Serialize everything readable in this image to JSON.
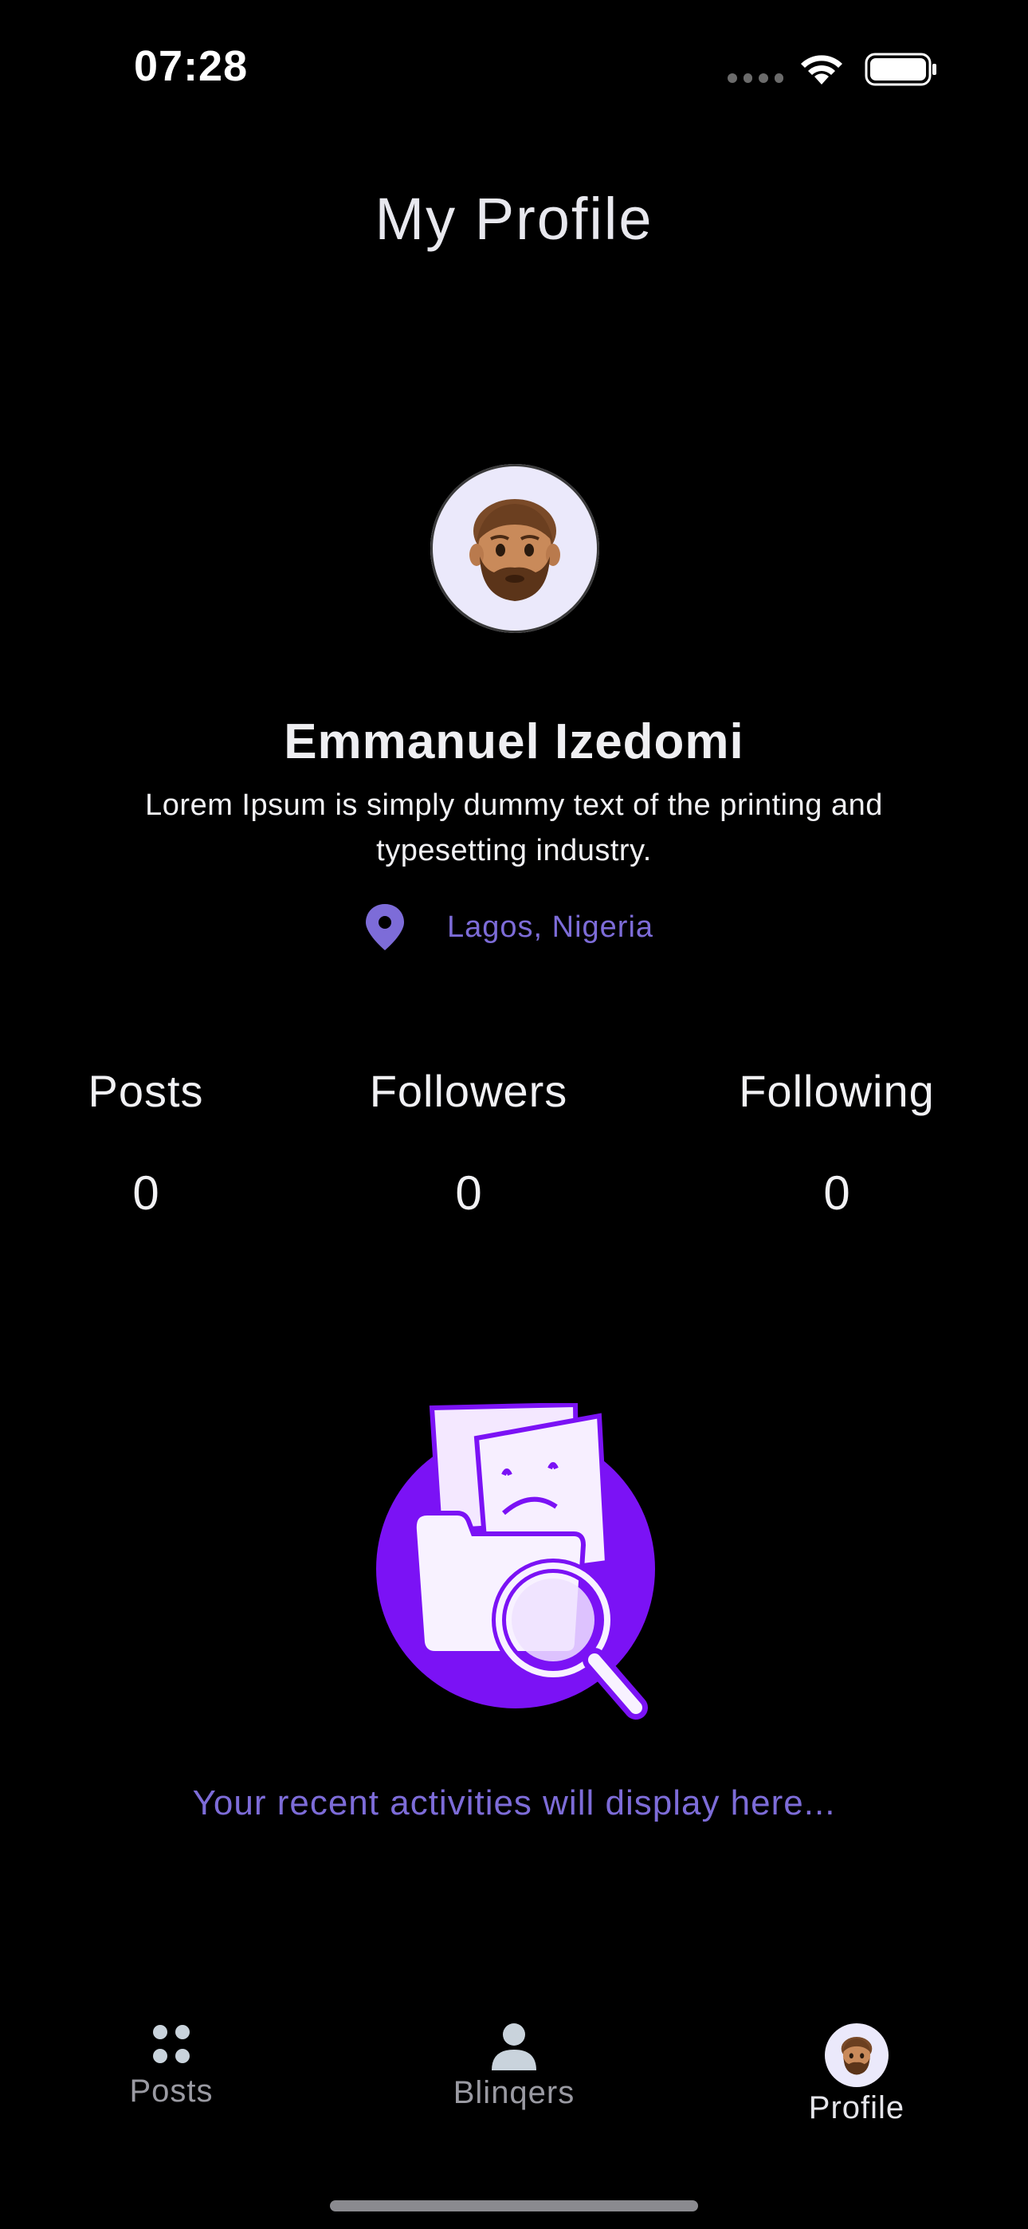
{
  "status_bar": {
    "time": "07:28"
  },
  "header": {
    "title": "My Profile"
  },
  "profile": {
    "name": "Emmanuel Izedomi",
    "bio": "Lorem Ipsum is simply dummy text of the printing and typesetting industry.",
    "location": "Lagos, Nigeria",
    "avatar_icon": "bearded-man-emoji-icon"
  },
  "stats": [
    {
      "label": "Posts",
      "value": "0"
    },
    {
      "label": "Followers",
      "value": "0"
    },
    {
      "label": "Following",
      "value": "0"
    }
  ],
  "activity": {
    "empty_message": "Your recent activities will display here...",
    "illustration_icon": "empty-folder-search-icon"
  },
  "bottom_nav": {
    "items": [
      {
        "label": "Posts",
        "icon": "dots-grid-icon"
      },
      {
        "label": "Blinqers",
        "icon": "person-icon"
      },
      {
        "label": "Profile",
        "icon": "avatar-icon",
        "active": true
      }
    ]
  },
  "colors": {
    "background": "#000000",
    "accent": "#7d6cd8",
    "illustration_purple": "#7b12f5",
    "text": "#f1f1f4",
    "nav_inactive": "#9a9aa2"
  }
}
